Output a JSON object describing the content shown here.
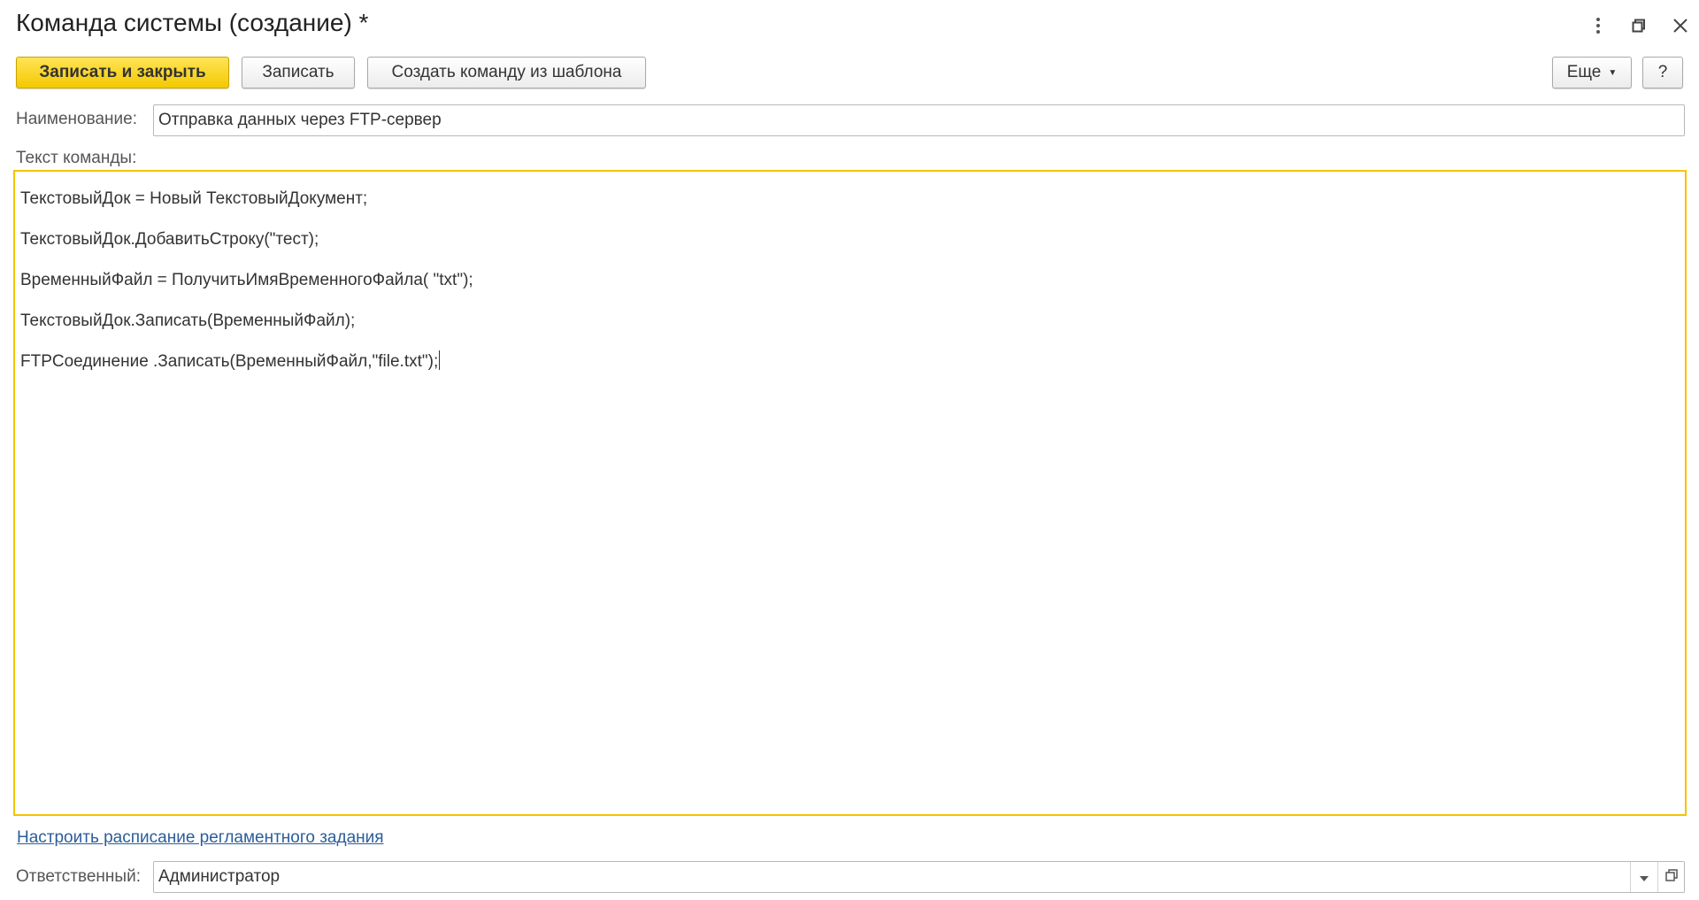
{
  "window": {
    "title": "Команда системы (создание) *",
    "more_icon": "vertical-dots-icon",
    "restore_icon": "restore-window-icon",
    "close_icon": "close-icon"
  },
  "toolbar": {
    "save_close_label": "Записать и закрыть",
    "save_label": "Записать",
    "create_from_template_label": "Создать команду из шаблона",
    "more_label": "Еще",
    "help_label": "?"
  },
  "form": {
    "name_label": "Наименование:",
    "name_value": "Отправка данных через FTP-сервер",
    "command_text_label": "Текст команды:",
    "code_lines": [
      "ТекстовыйДок = Новый ТекстовыйДокумент;",
      "ТекстовыйДок.ДобавитьСтроку(\"тест);",
      "ВременныйФайл = ПолучитьИмяВременногоФайла( \"txt\");",
      "ТекстовыйДок.Записать(ВременныйФайл);",
      "FTPСоединение .Записать(ВременныйФайл,\"file.txt\");"
    ],
    "schedule_link": "Настроить расписание регламентного задания",
    "responsible_label": "Ответственный:",
    "responsible_value": "Администратор"
  },
  "colors": {
    "accent_yellow": "#f4c900",
    "code_border": "#f5c300",
    "link": "#2b5d9b"
  }
}
